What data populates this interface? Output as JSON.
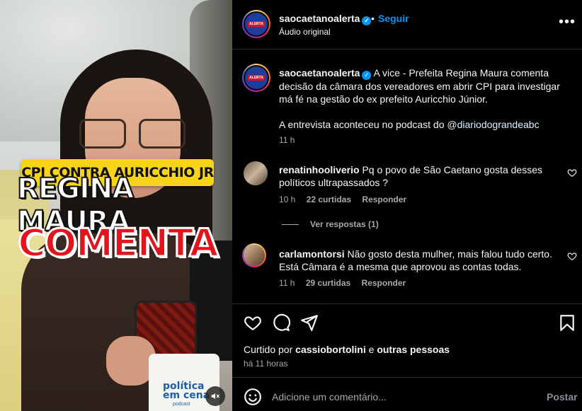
{
  "media": {
    "banner_line1": "CPI CONTRA AURICCHIO JR",
    "banner_line2": "REGINA MAURA",
    "banner_line3": "COMENTA",
    "mug_line1": "política",
    "mug_line2": "em cena",
    "mug_sub": "podcast",
    "mute_icon": "speaker-muted-icon"
  },
  "header": {
    "username": "saocaetanoalerta",
    "separator": "•",
    "follow_label": "Seguir",
    "subtitle": "Áudio original",
    "more_icon": "more-horizontal-icon"
  },
  "caption": {
    "username": "saocaetanoalerta",
    "text": "A vice - Prefeita Regina Maura comenta decisão da câmara dos vereadores em abrir CPI para investigar má fé na gestão do ex prefeito Auricchio Júnior.",
    "text2_prefix": "A entrevista aconteceu no podcast do ",
    "mention": "@diariodograndeabc",
    "time": "11 h"
  },
  "comments": [
    {
      "username": "renatinhooliverio",
      "text": "Pq o povo de São Caetano gosta desses políticos ultrapassados ?",
      "time": "10 h",
      "likes": "22 curtidas",
      "reply": "Responder",
      "view_replies": "Ver respostas (1)"
    },
    {
      "username": "carlamontorsi",
      "text": "Não gosto desta mulher, mais falou tudo certo. Está Câmara é a mesma que aprovou as contas todas.",
      "time": "11 h",
      "likes": "29 curtidas",
      "reply": "Responder"
    }
  ],
  "actions": {
    "like_icon": "heart-icon",
    "comment_icon": "comment-icon",
    "share_icon": "share-icon",
    "save_icon": "bookmark-icon"
  },
  "likes": {
    "prefix": "Curtido por ",
    "user": "cassiobortolini",
    "middle": " e ",
    "others": "outras pessoas"
  },
  "post_time": "há 11 horas",
  "comment_box": {
    "placeholder": "Adicione um comentário...",
    "post_label": "Postar",
    "emoji_icon": "emoji-icon"
  },
  "colors": {
    "accent": "#0095f6",
    "background": "#000000",
    "muted_text": "#a8a8a8",
    "banner_yellow": "#f7d41a",
    "banner_red": "#e3141c"
  }
}
